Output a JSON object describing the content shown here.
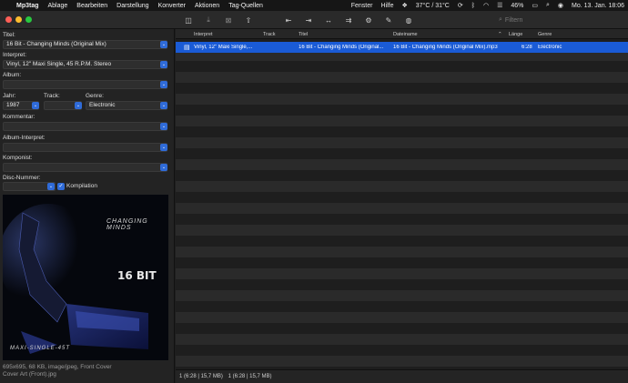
{
  "menubar": {
    "app": "Mp3tag",
    "items": [
      "Ablage",
      "Bearbeiten",
      "Darstellung",
      "Konverter",
      "Aktionen",
      "Tag-Quellen"
    ],
    "right_items": [
      "Fenster",
      "Hilfe"
    ],
    "weather": "37°C / 31°C",
    "battery": "46%",
    "datetime": "Mo. 13. Jan.  18:06"
  },
  "toolbar": {
    "filter_placeholder": "Filtern"
  },
  "tag_panel": {
    "titel_label": "Titel:",
    "titel_value": "16 Bit - Changing Minds (Original Mix)",
    "interpret_label": "Interpret:",
    "interpret_value": "Vinyl, 12\" Maxi Single, 45 R.P.M. Stereo",
    "album_label": "Album:",
    "album_value": "",
    "jahr_label": "Jahr:",
    "jahr_value": "1987",
    "track_label": "Track:",
    "track_value": "",
    "genre_label": "Genre:",
    "genre_value": "Electronic",
    "kommentar_label": "Kommentar:",
    "kommentar_value": "",
    "album_interpret_label": "Album-Interpret:",
    "album_interpret_value": "",
    "komponist_label": "Komponist:",
    "komponist_value": "",
    "disc_label": "Disc-Nummer:",
    "disc_value": "",
    "kompilation_label": "Kompilation",
    "cover_text_title": "CHANGING MINDS",
    "cover_text_logo": "16 BIT",
    "cover_text_bottom": "MAXI-SINGLE-45T",
    "cover_info_line1": "695x695, 68 KB, image/jpeg, Front Cover",
    "cover_info_line2": "Cover Art (Front).jpg"
  },
  "file_list": {
    "columns": [
      "Interpret",
      "Track",
      "Titel",
      "Dateiname",
      "Länge",
      "Genre"
    ],
    "rows": [
      {
        "interpret": "Vinyl, 12\" Maxi Single,...",
        "track": "",
        "titel": "16 Bit - Changing Minds (Original...",
        "dateiname": "16 Bit - Changing Minds (Original Mix).mp3",
        "laenge": "6:28",
        "genre": "Electronic"
      }
    ]
  },
  "status": {
    "left": "1 (6:28 | 15,7 MB)",
    "right": "1 (6:28 | 15,7 MB)"
  }
}
